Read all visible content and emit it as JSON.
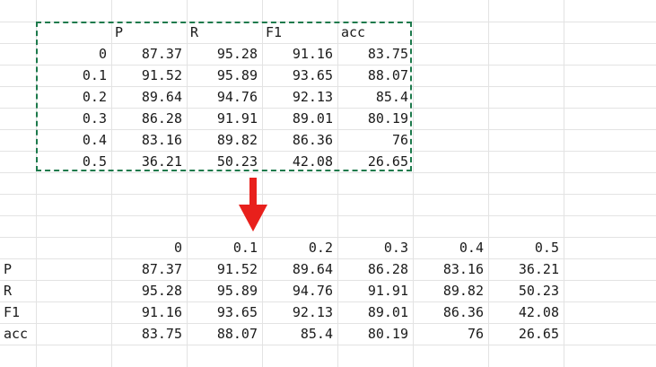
{
  "source_table": {
    "headers": [
      "P",
      "R",
      "F1",
      "acc"
    ],
    "rows": [
      {
        "label": "0",
        "values": [
          "87.37",
          "95.28",
          "91.16",
          "83.75"
        ]
      },
      {
        "label": "0.1",
        "values": [
          "91.52",
          "95.89",
          "93.65",
          "88.07"
        ]
      },
      {
        "label": "0.2",
        "values": [
          "89.64",
          "94.76",
          "92.13",
          "85.4"
        ]
      },
      {
        "label": "0.3",
        "values": [
          "86.28",
          "91.91",
          "89.01",
          "80.19"
        ]
      },
      {
        "label": "0.4",
        "values": [
          "83.16",
          "89.82",
          "86.36",
          "76"
        ]
      },
      {
        "label": "0.5",
        "values": [
          "36.21",
          "50.23",
          "42.08",
          "26.65"
        ]
      }
    ]
  },
  "transposed_table": {
    "headers": [
      "0",
      "0.1",
      "0.2",
      "0.3",
      "0.4",
      "0.5"
    ],
    "rows": [
      {
        "label": "P",
        "values": [
          "87.37",
          "91.52",
          "89.64",
          "86.28",
          "83.16",
          "36.21"
        ]
      },
      {
        "label": "R",
        "values": [
          "95.28",
          "95.89",
          "94.76",
          "91.91",
          "89.82",
          "50.23"
        ]
      },
      {
        "label": "F1",
        "values": [
          "91.16",
          "93.65",
          "92.13",
          "89.01",
          "86.36",
          "42.08"
        ]
      },
      {
        "label": "acc",
        "values": [
          "83.75",
          "88.07",
          "85.4",
          "80.19",
          "76",
          "26.65"
        ]
      }
    ]
  },
  "colors": {
    "selection_border": "#1d7a4c",
    "arrow": "#e8201c",
    "gridline": "#e3e3e3"
  },
  "icons": {
    "arrow": "down-arrow-icon"
  }
}
